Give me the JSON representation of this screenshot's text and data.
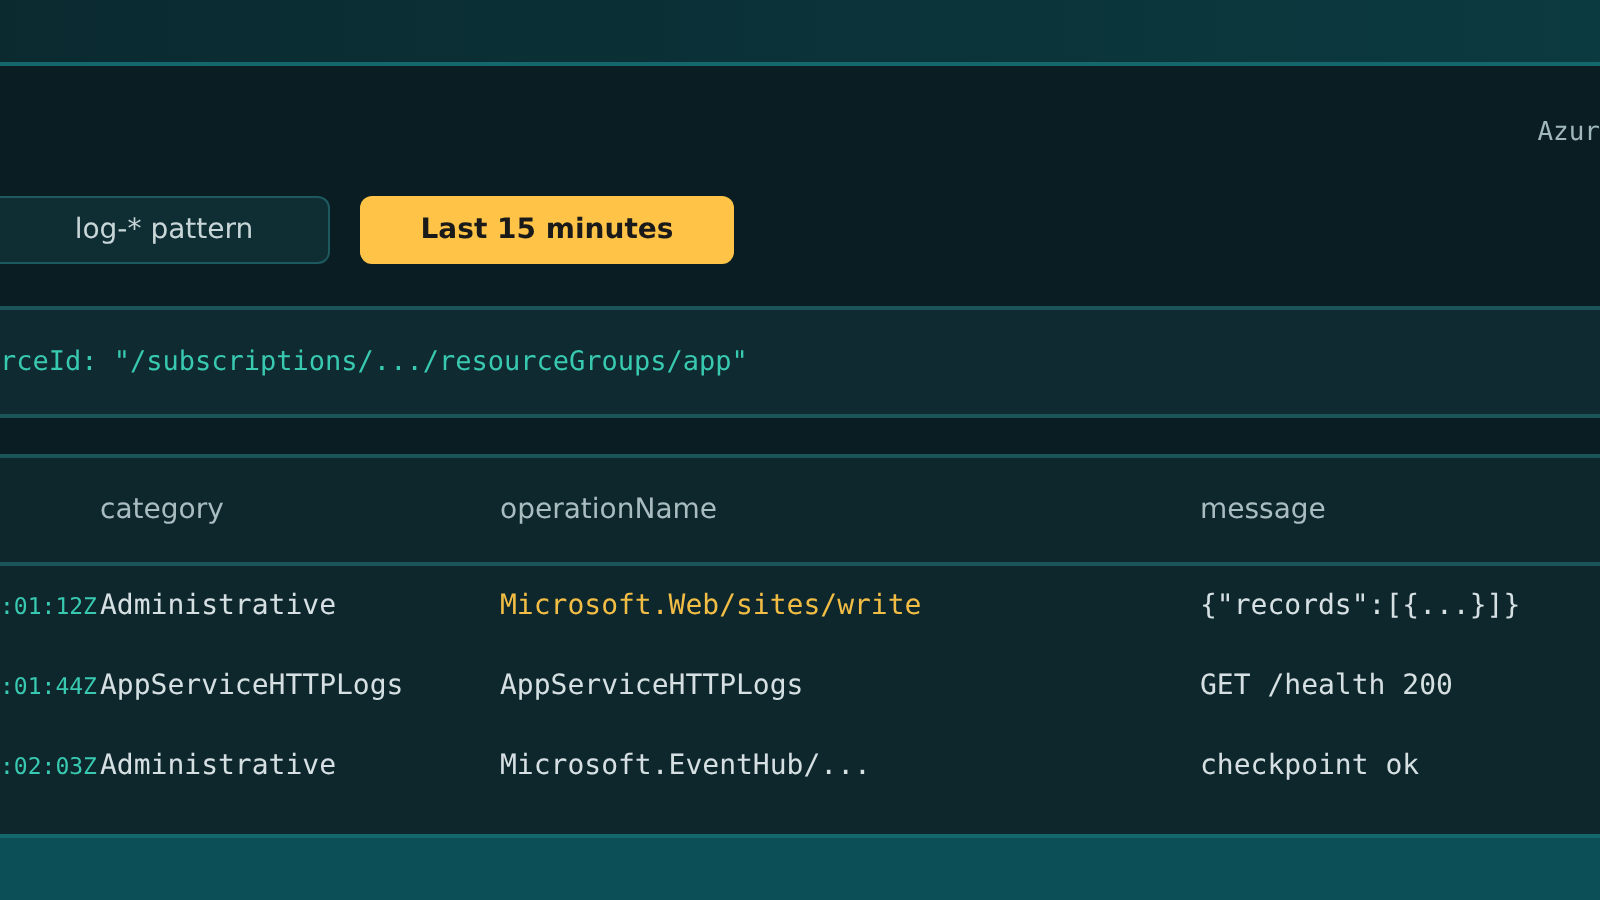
{
  "header": {
    "label": "Azur"
  },
  "filters": [
    {
      "label": "log-* pattern",
      "selected": false
    },
    {
      "label": "Last 15 minutes",
      "selected": true
    }
  ],
  "query": "rceId: \"/subscriptions/.../resourceGroups/app\"",
  "table": {
    "columns": [
      "category",
      "operationName",
      "message"
    ],
    "rows": [
      {
        "time": ":01:12Z",
        "category": "Administrative",
        "operation": "Microsoft.Web/sites/write",
        "message": "{\"records\":[{...}]}",
        "selected": true
      },
      {
        "time": ":01:44Z",
        "category": "AppServiceHTTPLogs",
        "operation": "AppServiceHTTPLogs",
        "message": "GET /health 200",
        "selected": false
      },
      {
        "time": ":02:03Z",
        "category": "Administrative",
        "operation": "Microsoft.EventHub/...",
        "message": "checkpoint ok",
        "selected": false
      }
    ]
  }
}
